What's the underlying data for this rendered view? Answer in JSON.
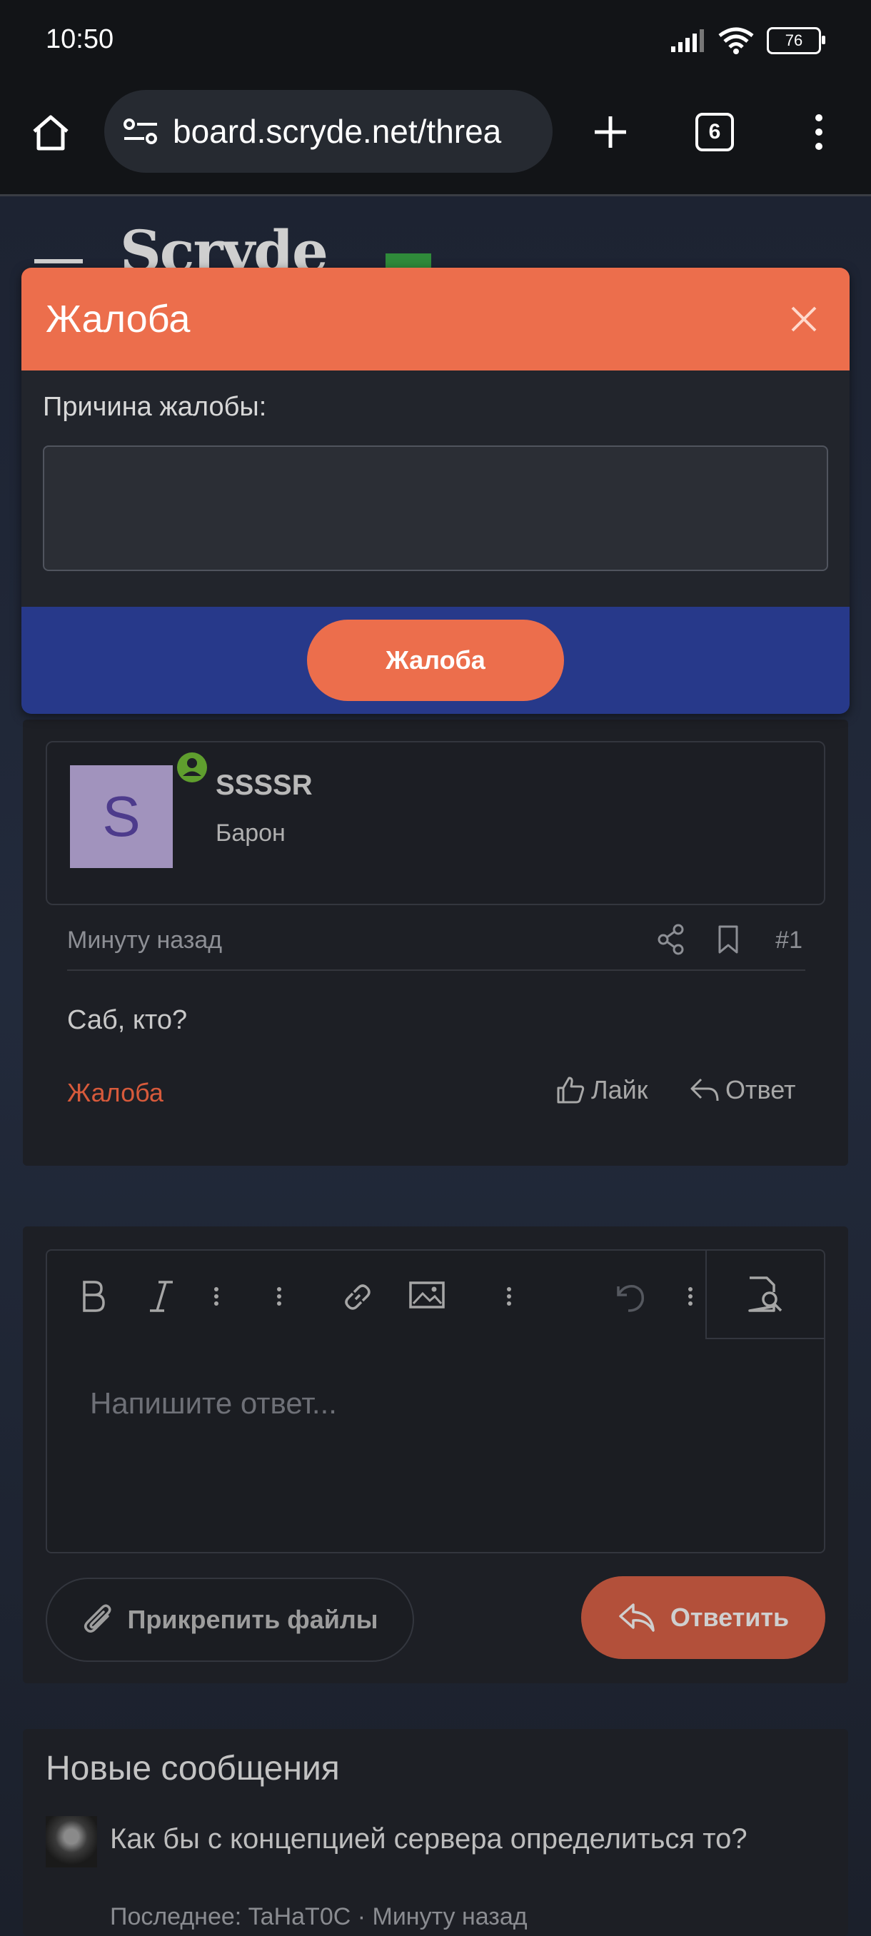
{
  "status_bar": {
    "time": "10:50",
    "battery": "76"
  },
  "browser": {
    "url": "board.scryde.net/threa",
    "tab_count": "6"
  },
  "site": {
    "logo_text": "Scryde"
  },
  "report_modal": {
    "title": "Жалоба",
    "reason_label": "Причина жалобы:",
    "reason_value": "",
    "submit_label": "Жалоба"
  },
  "post": {
    "avatar_letter": "S",
    "username": "SSSSR",
    "user_title": "Барон",
    "time": "Минуту назад",
    "number": "#1",
    "body": "Саб, кто?",
    "report_label": "Жалоба",
    "like_label": "Лайк",
    "reply_label": "Ответ"
  },
  "reply_editor": {
    "placeholder": "Напишите ответ...",
    "attach_label": "Прикрепить файлы",
    "send_label": "Ответить"
  },
  "new_posts": {
    "heading": "Новые сообщения",
    "items": [
      {
        "title": "Как бы с концепцией сервера определиться то?",
        "meta": "Последнее: TaHaT0C · Минуту назад"
      }
    ]
  },
  "colors": {
    "accent": "#ec6e4c",
    "footer_blue": "#27398a",
    "online_green": "#5f9e2e"
  }
}
